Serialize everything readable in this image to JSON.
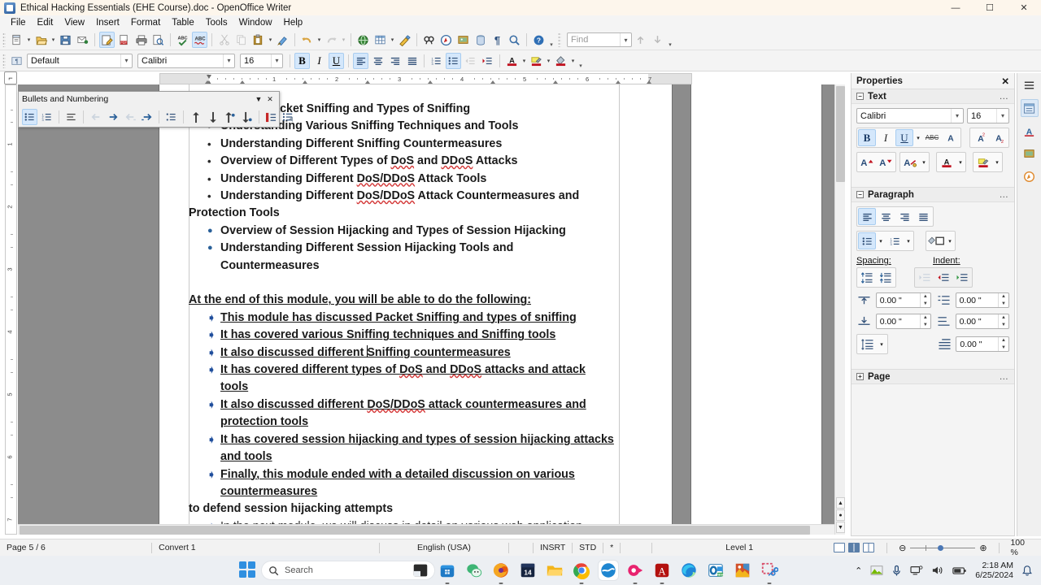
{
  "window": {
    "title": "Ethical Hacking Essentials (EHE Course).doc - OpenOffice Writer",
    "icon": "writer-doc-icon",
    "minimize": "—",
    "maximize": "☐",
    "close": "✕"
  },
  "menu": {
    "items": [
      "File",
      "Edit",
      "View",
      "Insert",
      "Format",
      "Table",
      "Tools",
      "Window",
      "Help"
    ]
  },
  "standard_toolbar": {
    "find_placeholder": "Find",
    "buttons": [
      {
        "name": "new-document",
        "glyph": "🗋"
      },
      {
        "name": "open-document",
        "glyph": "📂"
      },
      {
        "name": "save-document",
        "glyph": "💾"
      },
      {
        "name": "email-document",
        "glyph": "✉"
      },
      {
        "name": "edit-file",
        "glyph": "📝"
      },
      {
        "name": "export-pdf",
        "glyph": "📕"
      },
      {
        "name": "print-file",
        "glyph": "🖨"
      },
      {
        "name": "print-preview",
        "glyph": "🔎"
      },
      {
        "name": "spelling",
        "glyph": "✓"
      },
      {
        "name": "autospellcheck",
        "glyph": "ABC"
      },
      {
        "name": "cut",
        "glyph": "✂"
      },
      {
        "name": "copy",
        "glyph": "⧉"
      },
      {
        "name": "paste",
        "glyph": "📋"
      },
      {
        "name": "clone-formatting",
        "glyph": "🖌"
      },
      {
        "name": "undo",
        "glyph": "↶"
      },
      {
        "name": "redo",
        "glyph": "↷"
      },
      {
        "name": "hyperlink",
        "glyph": "🌐"
      },
      {
        "name": "insert-table",
        "glyph": "▦"
      },
      {
        "name": "show-draw-functions",
        "glyph": "✎"
      },
      {
        "name": "find-replace",
        "glyph": "🔭"
      },
      {
        "name": "navigator",
        "glyph": "🧭"
      },
      {
        "name": "gallery",
        "glyph": "🖼"
      },
      {
        "name": "data-sources",
        "glyph": "🗄"
      },
      {
        "name": "formatting-marks",
        "glyph": "¶"
      },
      {
        "name": "zoom",
        "glyph": "🔍"
      },
      {
        "name": "help",
        "glyph": "?"
      }
    ]
  },
  "formatting_toolbar": {
    "paragraph_style": "Default",
    "font_name": "Calibri",
    "font_size": "16",
    "bold": "B",
    "italic": "I",
    "underline": "U",
    "align_left": "≡",
    "align_center": "≡",
    "align_right": "≡",
    "justify": "≡",
    "ordered_list": "1≡",
    "unordered_list": "•≡",
    "decrease_indent": "⇤",
    "increase_indent": "⇥",
    "font_color": "A",
    "highlight": "✎",
    "background_color": "◧",
    "active": [
      "bold",
      "underline",
      "align_left",
      "unordered_list"
    ]
  },
  "bullets_toolbar": {
    "title": "Bullets and Numbering",
    "collapse_glyph": "▼",
    "close_glyph": "✕",
    "buttons": [
      {
        "name": "unordered-list",
        "glyph": "•≡",
        "active": true
      },
      {
        "name": "ordered-list",
        "glyph": "1≡",
        "active": false
      },
      {
        "name": "no-list",
        "glyph": "≡",
        "active": false
      },
      {
        "name": "promote",
        "glyph": "⇐",
        "active": false
      },
      {
        "name": "demote",
        "glyph": "⇒",
        "active": false
      },
      {
        "name": "promote-with-subpoints",
        "glyph": "⇦",
        "active": false
      },
      {
        "name": "demote-with-subpoints",
        "glyph": "⇨",
        "active": false
      },
      {
        "name": "insert-unnumbered-entry",
        "glyph": "≡",
        "active": false
      },
      {
        "name": "move-up",
        "glyph": "⇧",
        "active": false
      },
      {
        "name": "move-down",
        "glyph": "⇩",
        "active": false
      },
      {
        "name": "move-up-with-subpoints",
        "glyph": "⇪",
        "active": false
      },
      {
        "name": "move-down-with-subpoints",
        "glyph": "⇫",
        "active": false
      },
      {
        "name": "restart-numbering",
        "glyph": "❙≡",
        "active": false
      },
      {
        "name": "bullets-and-numbering-dialog",
        "glyph": "☷",
        "active": false
      }
    ]
  },
  "ruler": {
    "horizontal_labels": [
      "1",
      "2",
      "3",
      "4",
      "5",
      "6",
      "7"
    ],
    "vertical_labels": [
      "1",
      "2",
      "3",
      "4",
      "5",
      "6",
      "7"
    ]
  },
  "document": {
    "blocks": [
      {
        "type": "bullet1",
        "bullet": "•",
        "text": "tanding Packet Sniffing and Types of Sniffing",
        "underline": false,
        "clipped": true
      },
      {
        "type": "bullet1",
        "bullet": "•",
        "text": "Understanding Various Sniffing Techniques and Tools",
        "underline": false
      },
      {
        "type": "bullet1",
        "bullet": "•",
        "text": "Understanding Different Sniffing Countermeasures",
        "underline": false
      },
      {
        "type": "bullet1",
        "bullet": "•",
        "text": "Overview of Different Types of DoS and DDoS Attacks",
        "underline": false,
        "misspelled": [
          "DoS",
          "DDoS"
        ]
      },
      {
        "type": "bullet1",
        "bullet": "•",
        "text": "Understanding Different DoS/DDoS Attack Tools",
        "underline": false,
        "misspelled": [
          "DoS/DDoS"
        ]
      },
      {
        "type": "bullet1",
        "bullet": "•",
        "text": "Understanding Different DoS/DDoS Attack Countermeasures and",
        "underline": false,
        "misspelled": [
          "DoS/DDoS"
        ]
      },
      {
        "type": "plain",
        "text": "Protection Tools",
        "underline": false
      },
      {
        "type": "bullet-blue",
        "bullet": "●",
        "text": "Overview of Session Hijacking and Types of Session Hijacking",
        "underline": false
      },
      {
        "type": "bullet-blue",
        "bullet": "●",
        "text": "Understanding Different Session Hijacking Tools and",
        "underline": false
      },
      {
        "type": "cont",
        "text": "Countermeasures",
        "underline": false
      },
      {
        "type": "blank",
        "text": ""
      },
      {
        "type": "plain-underline",
        "text": "At the end of this module, you will be able to do the following:",
        "underline": true
      },
      {
        "type": "bullet-diamond",
        "bullet": "⮞",
        "text": " This module has discussed Packet Sniffing and types of sniffing",
        "underline": true
      },
      {
        "type": "bullet-diamond",
        "bullet": "⮞",
        "text": " It has covered various Sniffing techniques and Sniffing tools",
        "underline": true
      },
      {
        "type": "bullet-diamond",
        "bullet": "⮞",
        "text": " It also discussed different Sniffing countermeasures",
        "underline": true,
        "caret_after": "S"
      },
      {
        "type": "bullet-diamond",
        "bullet": "⮞",
        "text": " It has covered different types of DoS and DDoS attacks and attack",
        "underline": true,
        "misspelled": [
          "DoS",
          "DDoS"
        ]
      },
      {
        "type": "cont-underline",
        "text": "tools",
        "underline": true
      },
      {
        "type": "bullet-diamond",
        "bullet": "⮞",
        "text": " It also discussed different DoS/DDoS attack countermeasures and",
        "underline": true,
        "misspelled": [
          "DoS/DDoS"
        ]
      },
      {
        "type": "cont-underline",
        "text": "protection tools",
        "underline": true
      },
      {
        "type": "bullet-diamond",
        "bullet": "⮞",
        "text": " It has covered session hijacking and types of session hijacking attacks",
        "underline": true
      },
      {
        "type": "cont-underline",
        "text": "and tools",
        "underline": true
      },
      {
        "type": "bullet-diamond",
        "bullet": "⮞",
        "text": " Finally, this module ended with a detailed discussion on various",
        "underline": true
      },
      {
        "type": "cont-underline",
        "text": "countermeasures",
        "underline": true
      },
      {
        "type": "plain",
        "text": "to defend session hijacking attempts",
        "underline": false
      },
      {
        "type": "bullet-diamond-normal",
        "bullet": "⮞",
        "text": "In the next module, we will discuss in detail on various web application",
        "underline": false
      }
    ]
  },
  "sidebar": {
    "title": "Properties",
    "close_glyph": "✕",
    "text_panel": {
      "title": "Text",
      "expander": "−",
      "more": "…",
      "font_name": "Calibri",
      "font_size": "16",
      "buttons": [
        {
          "name": "bold",
          "label": "B",
          "active": true
        },
        {
          "name": "italic",
          "label": "I",
          "active": false
        },
        {
          "name": "underline",
          "label": "U",
          "active": true
        },
        {
          "name": "strikethrough",
          "label": "ABC",
          "active": false
        },
        {
          "name": "shadow",
          "label": "A",
          "active": false
        },
        {
          "name": "superscript",
          "label": "A²",
          "active": false
        },
        {
          "name": "subscript",
          "label": "A₂",
          "active": false
        },
        {
          "name": "increase-font-size",
          "label": "A",
          "active": false
        },
        {
          "name": "decrease-font-size",
          "label": "A",
          "active": false
        },
        {
          "name": "character-highlighting",
          "label": "A",
          "active": false
        },
        {
          "name": "font-color",
          "label": "A",
          "active": false
        },
        {
          "name": "highlighting-color",
          "label": "✎",
          "active": false
        }
      ]
    },
    "paragraph_panel": {
      "title": "Paragraph",
      "expander": "−",
      "more": "…",
      "align_left": "≡",
      "align_center": "≡",
      "align_right": "≡",
      "justify": "≡",
      "unordered_list": "•≡",
      "ordered_list": "1≡",
      "background_color": "◧",
      "spacing_label": "Spacing:",
      "indent_label": "Indent:",
      "above_spacing": "0.00 \"",
      "below_spacing": "0.00 \"",
      "before_text_indent": "0.00 \"",
      "after_text_indent": "0.00 \"",
      "first_line_indent": "0.00 \"",
      "line_spacing": "↕≡"
    },
    "page_panel": {
      "title": "Page",
      "expander": "+",
      "more": "…"
    },
    "icon_strip": [
      {
        "name": "sidebar-settings",
        "glyph": "≡"
      },
      {
        "name": "properties-deck",
        "glyph": "⧉"
      },
      {
        "name": "styles-deck",
        "glyph": "Ⓐ"
      },
      {
        "name": "gallery-deck",
        "glyph": "❖"
      },
      {
        "name": "navigator-deck",
        "glyph": "☉"
      }
    ]
  },
  "statusbar": {
    "page": "Page 5 / 6",
    "word_count": "Convert 1",
    "language": "English (USA)",
    "insert_mode": "INSRT",
    "selection_mode": "STD",
    "modified": "*",
    "outline_level": "Level 1",
    "zoom_value": "100 %",
    "zoom_out": "⊖",
    "zoom_in": "⊕"
  },
  "taskbar": {
    "search_placeholder": "Search",
    "search_icon": "🔍",
    "time": "2:18 AM",
    "date": "6/25/2024",
    "items": [
      {
        "name": "taskbar-start",
        "glyph": "⊞",
        "color": "#2f8fe0"
      },
      {
        "name": "taskbar-file-explorer",
        "glyph": "◰",
        "color": "#2b2b2b"
      },
      {
        "name": "taskbar-microsoft-store",
        "glyph": "🛍",
        "color": "#1f7ac6"
      },
      {
        "name": "taskbar-wechat",
        "glyph": "💬",
        "color": "#3eb575"
      },
      {
        "name": "taskbar-firefox",
        "glyph": "🦊",
        "color": "#e8590c"
      },
      {
        "name": "taskbar-calendar",
        "glyph": "14",
        "color": "#1b2a4a"
      },
      {
        "name": "taskbar-file-folder",
        "glyph": "📁",
        "color": "#f3b51c"
      },
      {
        "name": "taskbar-chrome",
        "glyph": "◉",
        "color": "#2d8cf0"
      },
      {
        "name": "taskbar-openoffice",
        "glyph": "≈",
        "color": "#1f77bd"
      },
      {
        "name": "taskbar-screen-recorder",
        "glyph": "●",
        "color": "#e8236f"
      },
      {
        "name": "taskbar-adobe-acrobat",
        "glyph": "A",
        "color": "#b3110f"
      },
      {
        "name": "taskbar-edge",
        "glyph": "◑",
        "color": "#1f86d8"
      },
      {
        "name": "taskbar-outlook",
        "glyph": "O",
        "color": "#1a6fae"
      },
      {
        "name": "taskbar-photos",
        "glyph": "◱",
        "color": "#d2512b"
      },
      {
        "name": "taskbar-snipping-tool",
        "glyph": "✂",
        "color": "#d94f6a"
      }
    ],
    "tray": [
      {
        "name": "show-hidden-icons",
        "glyph": "∧"
      },
      {
        "name": "nvidia-icon",
        "glyph": "◢"
      },
      {
        "name": "microphone-icon",
        "glyph": "🎙"
      },
      {
        "name": "remote-desktop-icon",
        "glyph": "🖥"
      },
      {
        "name": "volume-icon",
        "glyph": "🔊"
      },
      {
        "name": "battery-icon",
        "glyph": "🔋"
      },
      {
        "name": "notification-bell-icon",
        "glyph": "🔔"
      }
    ]
  }
}
